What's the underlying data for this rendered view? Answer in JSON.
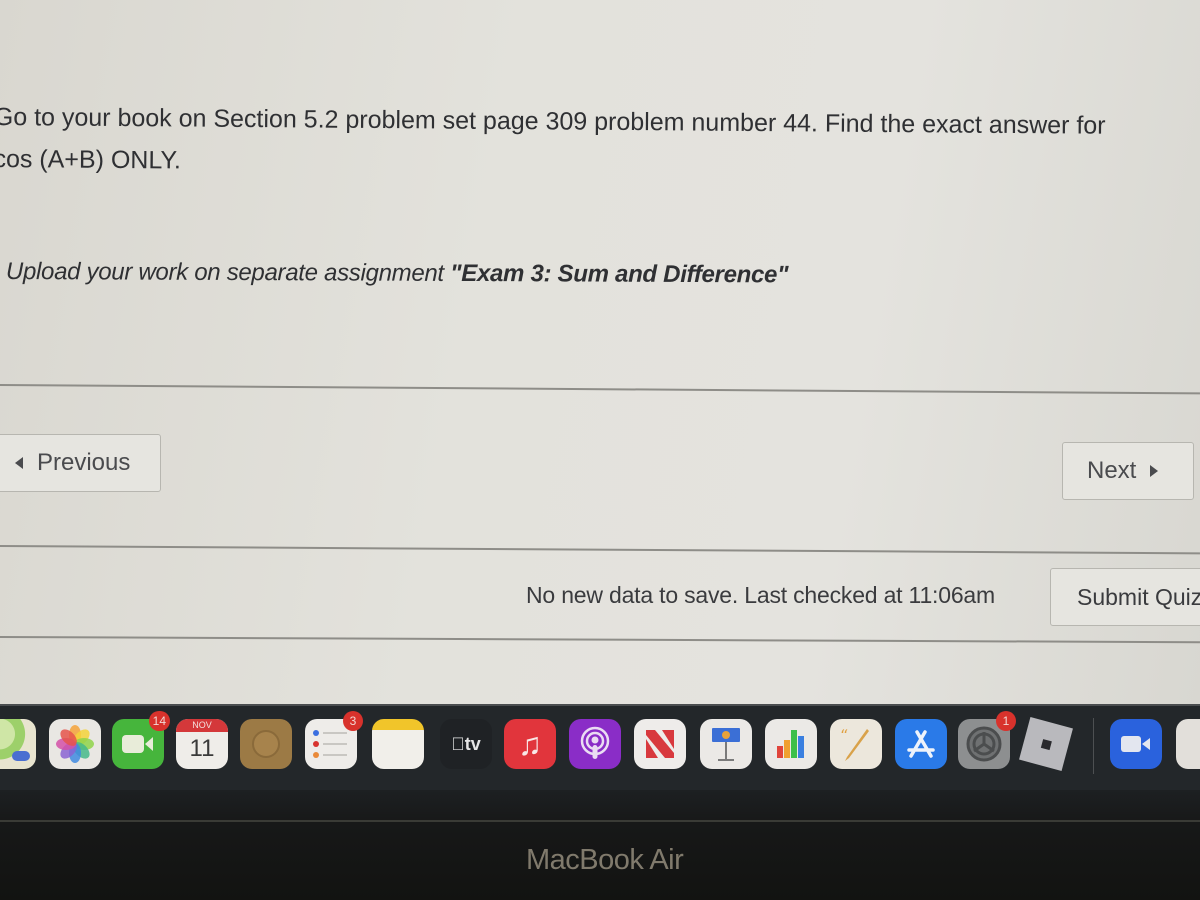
{
  "question": {
    "line1": "Go to your book on Section 5.2 problem set page 309 problem number 44. Find the exact answer for",
    "line2": "cos (A+B) ONLY.",
    "upload_prefix": "Upload your work on separate assignment ",
    "assignment_name": "\"Exam 3: Sum and Difference\""
  },
  "navigation": {
    "previous_label": "Previous",
    "next_label": "Next"
  },
  "footer": {
    "status_text": "No new data to save. Last checked at 11:06am",
    "submit_label": "Submit Quiz"
  },
  "dock": {
    "items": [
      {
        "name": "Maps",
        "icon": "maps-icon"
      },
      {
        "name": "Photos",
        "icon": "photos-icon"
      },
      {
        "name": "FaceTime",
        "icon": "facetime-icon",
        "badge": "14"
      },
      {
        "name": "Calendar",
        "icon": "calendar-icon",
        "month": "NOV",
        "day": "11"
      },
      {
        "name": "Contacts",
        "icon": "contacts-icon"
      },
      {
        "name": "Reminders",
        "icon": "reminders-icon",
        "badge": "3"
      },
      {
        "name": "Notes",
        "icon": "notes-icon"
      },
      {
        "name": "TV",
        "icon": "apple-tv-icon",
        "label": "tv"
      },
      {
        "name": "Music",
        "icon": "music-icon"
      },
      {
        "name": "Podcasts",
        "icon": "podcasts-icon"
      },
      {
        "name": "News",
        "icon": "news-icon"
      },
      {
        "name": "Keynote",
        "icon": "keynote-icon"
      },
      {
        "name": "Numbers",
        "icon": "numbers-icon"
      },
      {
        "name": "Pages",
        "icon": "pages-icon"
      },
      {
        "name": "App Store",
        "icon": "app-store-icon"
      },
      {
        "name": "System Preferences",
        "icon": "system-preferences-icon",
        "badge": "1"
      },
      {
        "name": "Roblox",
        "icon": "roblox-icon"
      },
      {
        "name": "Zoom",
        "icon": "zoom-icon"
      },
      {
        "name": "Document",
        "icon": "document-icon"
      }
    ]
  },
  "device": {
    "brand_label": "MacBook Air"
  }
}
